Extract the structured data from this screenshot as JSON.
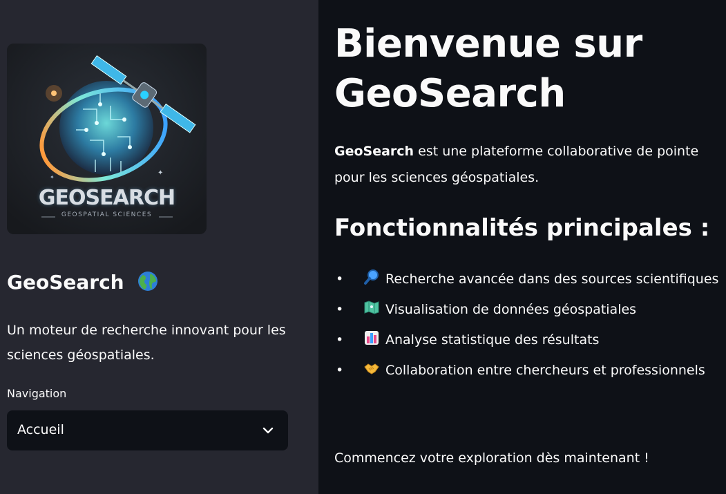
{
  "sidebar": {
    "logo": {
      "wordmark": "GEOSEARCH",
      "tagline": "GEOSPATIAL SCIENCES"
    },
    "title": "GeoSearch",
    "title_emoji_icon": "globe-icon",
    "description": "Un moteur de recherche innovant pour les sciences géospatiales.",
    "nav_label": "Navigation",
    "nav_selected": "Accueil"
  },
  "main": {
    "heading": "Bienvenue sur GeoSearch",
    "intro_strong": "GeoSearch",
    "intro_rest": " est une plateforme collaborative de pointe pour les sciences géospatiales.",
    "features_heading": "Fonctionnalités principales :",
    "features": [
      {
        "icon": "magnifier-icon",
        "label": "Recherche avancée dans des sources scientifiques"
      },
      {
        "icon": "map-icon",
        "label": "Visualisation de données géospatiales"
      },
      {
        "icon": "bar-chart-icon",
        "label": "Analyse statistique des résultats"
      },
      {
        "icon": "handshake-icon",
        "label": "Collaboration entre chercheurs et professionnels"
      }
    ],
    "outro": "Commencez votre exploration dès maintenant !"
  },
  "colors": {
    "main_bg": "#0e1117",
    "sidebar_bg": "#262730",
    "text": "#fafafa",
    "select_bg": "#0e1117"
  }
}
